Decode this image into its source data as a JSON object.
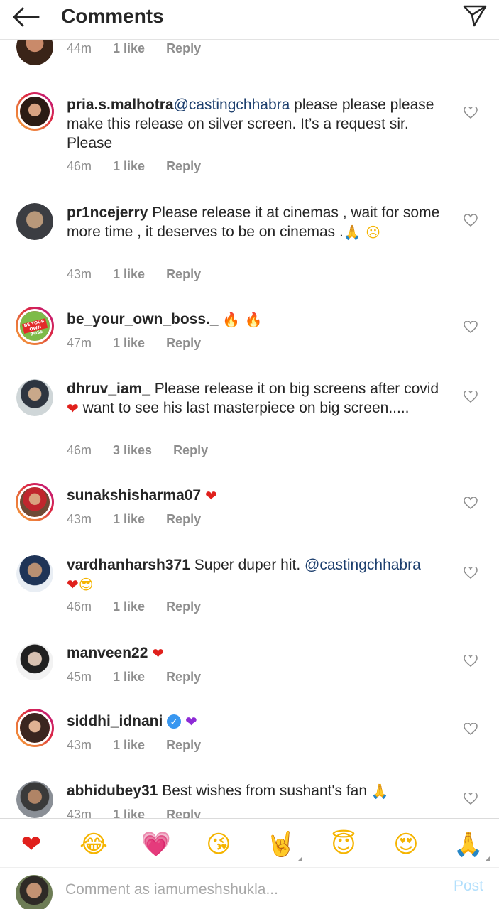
{
  "header": {
    "title": "Comments",
    "back_icon": "back-arrow-icon",
    "send_icon": "direct-send-icon"
  },
  "comments": [
    {
      "username": "",
      "text": "",
      "time": "44m",
      "likes": "1 like",
      "reply": "Reply"
    },
    {
      "username": "pria.s.malhotra",
      "mention": "@castingchhabra",
      "text": " please please please make this release on silver screen. It’s a request sir. Please",
      "time": "46m",
      "likes": "1 like",
      "reply": "Reply"
    },
    {
      "username": "pr1ncejerry",
      "text": " Please release it at cinemas , wait for some more time , it deserves to be on cinemas .",
      "emoji": "🙏 ☹",
      "time": "43m",
      "likes": "1 like",
      "reply": "Reply"
    },
    {
      "username": "be_your_own_boss._",
      "emoji": "🔥 🔥",
      "time": "47m",
      "likes": "1 like",
      "reply": "Reply",
      "avatar_text": "BE YOUR OWN BOSS"
    },
    {
      "username": "dhruv_iam_",
      "text_a": " Please release it on big screens after covid",
      "text_b": " want to see his last masterpiece on big screen.....",
      "time": "46m",
      "likes": "3 likes",
      "reply": "Reply"
    },
    {
      "username": "sunakshisharma07",
      "time": "43m",
      "likes": "1 like",
      "reply": "Reply"
    },
    {
      "username": "vardhanharsh371",
      "text": " Super duper hit. ",
      "mention": "@castingchhabra",
      "emoji": "😎",
      "time": "46m",
      "likes": "1 like",
      "reply": "Reply"
    },
    {
      "username": "manveen22",
      "time": "45m",
      "likes": "1 like",
      "reply": "Reply"
    },
    {
      "username": "siddhi_idnani",
      "time": "43m",
      "likes": "1 like",
      "reply": "Reply"
    },
    {
      "username": "abhidubey31",
      "text": " Best wishes from sushant's fan ",
      "emoji": "🙏",
      "time": "43m",
      "likes": "1 like",
      "reply": "Reply"
    }
  ],
  "emoji_bar": [
    {
      "glyph": "❤",
      "name": "red-heart",
      "color": "#e0201c"
    },
    {
      "glyph": "😂",
      "name": "tears-of-joy",
      "color": "#f5b400"
    },
    {
      "glyph": "💗",
      "name": "growing-heart",
      "color": "#ee4d7a"
    },
    {
      "glyph": "😘",
      "name": "face-blowing-kiss",
      "color": "#f5b400"
    },
    {
      "glyph": "🤘",
      "name": "sign-of-horns",
      "color": "#f5b400"
    },
    {
      "glyph": "😇",
      "name": "smiling-halo",
      "color": "#f5b400"
    },
    {
      "glyph": "😍",
      "name": "heart-eyes",
      "color": "#f5b400"
    },
    {
      "glyph": "🙏",
      "name": "folded-hands",
      "color": "#f5b400"
    }
  ],
  "input": {
    "placeholder": "Comment as iamumeshshukla...",
    "post_label": "Post"
  },
  "colors": {
    "mention": "#1d3f6e",
    "meta": "#8e8e8e",
    "post_disabled": "#b2dffc"
  }
}
